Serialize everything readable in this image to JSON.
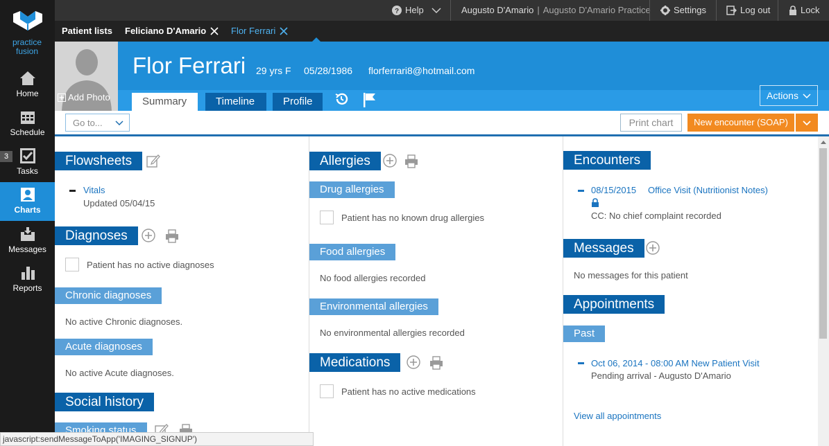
{
  "brand": {
    "name": "practice fusion"
  },
  "colors": {
    "primary": "#1f8ed8",
    "dark_blue": "#0a62a8",
    "light_blue": "#5aa0d8",
    "accent_orange": "#f28a20",
    "nav_bg": "#1b1b1b"
  },
  "sidebar": {
    "items": [
      {
        "label": "Home",
        "icon": "home-icon"
      },
      {
        "label": "Schedule",
        "icon": "calendar-icon"
      },
      {
        "label": "Tasks",
        "icon": "checkbox-icon",
        "badge": "3"
      },
      {
        "label": "Charts",
        "icon": "person-card-icon",
        "active": true
      },
      {
        "label": "Messages",
        "icon": "inbox-icon"
      },
      {
        "label": "Reports",
        "icon": "bar-chart-icon"
      }
    ]
  },
  "topbar": {
    "help": "Help",
    "user_name": "Augusto D'Amario",
    "practice": "Augusto D'Amario Practice",
    "settings": "Settings",
    "logout": "Log out",
    "lock": "Lock"
  },
  "tabs": {
    "patient_lists": "Patient lists",
    "open": [
      "Feliciano D'Amario",
      "Flor Ferrari"
    ]
  },
  "patient": {
    "name": "Flor Ferrari",
    "age_sex": "29 yrs F",
    "dob": "05/28/1986",
    "email": "florferrari8@hotmail.com",
    "add_photo": "Add Photo"
  },
  "header_tabs": {
    "summary": "Summary",
    "timeline": "Timeline",
    "profile": "Profile",
    "actions": "Actions"
  },
  "toolbar": {
    "goto": "Go to...",
    "print_chart": "Print chart",
    "new_encounter": "New encounter (SOAP)"
  },
  "col1": {
    "flowsheets": "Flowsheets",
    "vitals_link": "Vitals",
    "vitals_updated": "Updated 05/04/15",
    "diagnoses": "Diagnoses",
    "no_diagnoses": "Patient has no active diagnoses",
    "chronic": "Chronic diagnoses",
    "no_chronic": "No active Chronic diagnoses.",
    "acute": "Acute diagnoses",
    "no_acute": "No active Acute diagnoses.",
    "social_history": "Social history",
    "smoking_status": "Smoking status"
  },
  "col2": {
    "allergies": "Allergies",
    "drug_allergies": "Drug allergies",
    "no_drug": "Patient has no known drug allergies",
    "food_allergies": "Food allergies",
    "no_food": "No food allergies recorded",
    "env_allergies": "Environmental allergies",
    "no_env": "No environmental allergies recorded",
    "medications": "Medications",
    "no_meds": "Patient has no active medications"
  },
  "col3": {
    "encounters": "Encounters",
    "enc_date": "08/15/2015",
    "enc_type": "Office Visit (Nutritionist Notes)",
    "enc_cc": "CC: No chief complaint recorded",
    "messages": "Messages",
    "no_messages": "No messages for this patient",
    "appointments": "Appointments",
    "past": "Past",
    "appt_link": "Oct 06, 2014 - 08:00 AM New Patient Visit",
    "appt_status": "Pending arrival - Augusto D'Amario",
    "view_all": "View all appointments"
  },
  "statusbar": {
    "text": "javascript:sendMessageToApp('IMAGING_SIGNUP')"
  }
}
